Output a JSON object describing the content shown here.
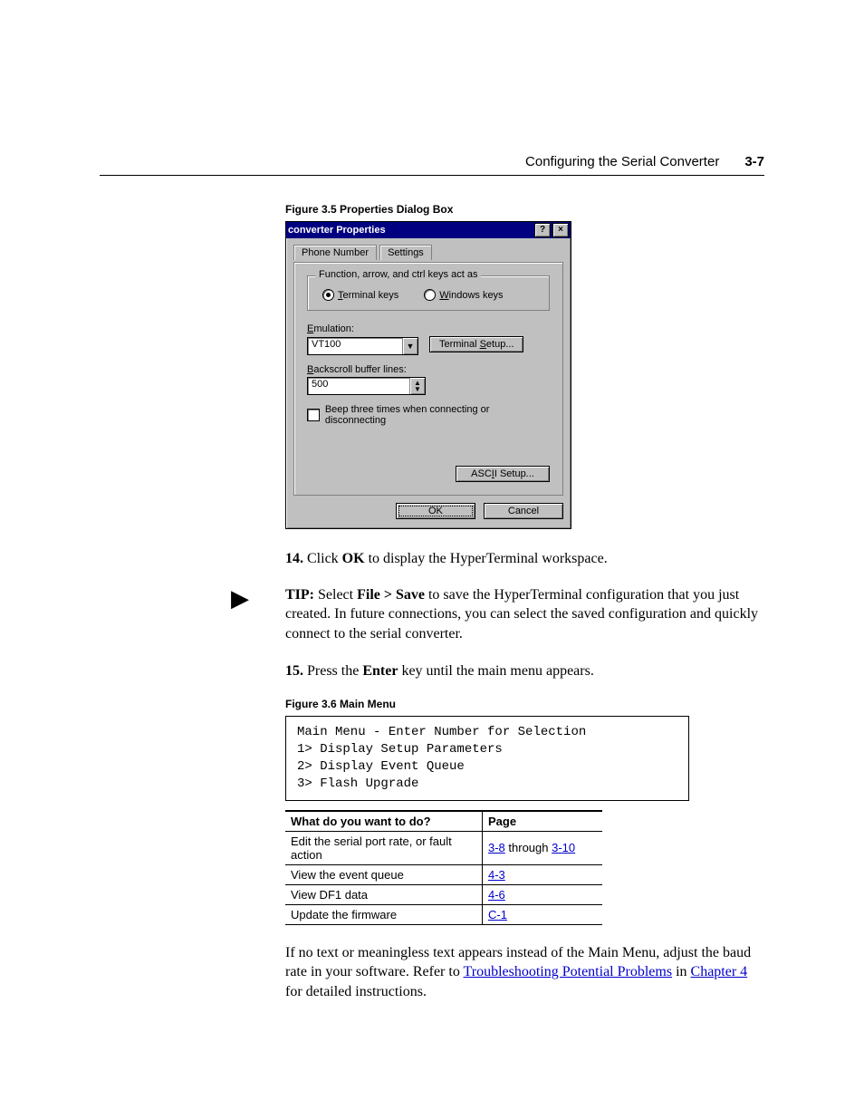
{
  "header": {
    "title": "Configuring the Serial Converter",
    "page_number": "3-7"
  },
  "fig1": {
    "caption": "Figure 3.5   Properties Dialog Box",
    "dialog": {
      "title": "converter Properties",
      "tabs": {
        "phone": "Phone Number",
        "settings": "Settings"
      },
      "group_legend": "Function, arrow, and ctrl keys act as",
      "radio_terminal_pre": "T",
      "radio_terminal_rest": "erminal keys",
      "radio_windows_pre": "W",
      "radio_windows_rest": "indows keys",
      "emu_label_pre": "E",
      "emu_label_rest": "mulation:",
      "emu_value": "VT100",
      "term_setup_btn": "Terminal Setup...",
      "backscroll_label_pre": "B",
      "backscroll_label_rest": "ackscroll buffer lines:",
      "backscroll_value": "500",
      "beep_label": "Beep three times when connecting or disconnecting",
      "ascii_btn_pre": "ASC",
      "ascii_btn_und": "I",
      "ascii_btn_post": "I Setup...",
      "ok_btn": "OK",
      "cancel_btn": "Cancel",
      "help_glyph": "?",
      "close_glyph": "×"
    }
  },
  "step14": {
    "num": "14.",
    "pre": " Click ",
    "b1": "OK",
    "post": " to display the HyperTerminal workspace."
  },
  "tip": {
    "label": "TIP:",
    "t1": "  Select ",
    "b1": "File > Save",
    "t2": " to save the HyperTerminal configuration that you just created. In future connections, you can select the saved configuration and quickly connect to the serial converter."
  },
  "step15": {
    "num": "15.",
    "pre": " Press the ",
    "b1": "Enter",
    "post": " key until the main menu appears."
  },
  "fig2": {
    "caption": "Figure 3.6   Main Menu",
    "lines": "Main Menu - Enter Number for Selection\n1> Display Setup Parameters\n2> Display Event Queue\n3> Flash Upgrade"
  },
  "table": {
    "h1": "What do you want to do?",
    "h2": "Page",
    "rows": [
      {
        "t": "Edit the serial port rate, or fault action",
        "p_pre": "3-8",
        "p_mid": " through ",
        "p_post": "3-10"
      },
      {
        "t": "View the event queue",
        "p": "4-3"
      },
      {
        "t": "View DF1 data",
        "p": "4-6"
      },
      {
        "t": "Update the firmware",
        "p": "C-1"
      }
    ]
  },
  "closing": {
    "t1": "If no text or meaningless text appears instead of the Main Menu, adjust the baud rate in your software. Refer to ",
    "l1": "Troubleshooting Potential Problems",
    "t2": " in ",
    "l2": "Chapter 4",
    "t3": " for detailed instructions."
  }
}
